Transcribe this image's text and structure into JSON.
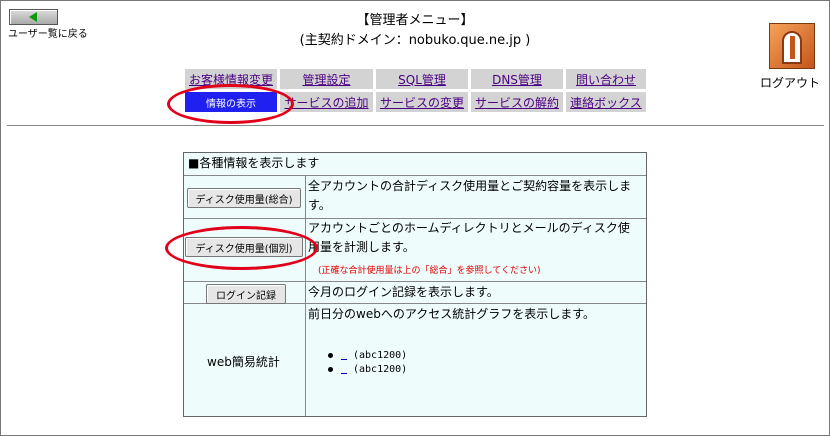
{
  "header": {
    "back_label": "ユーザー覧に戻る",
    "title": "【管理者メニュー】",
    "domain_line": "(主契約ドメイン：nobuko.que.ne.jp )",
    "logout_label": "ログアウト"
  },
  "menu": {
    "row1": [
      "お客様情報変更",
      "管理設定",
      "SQL管理",
      "DNS管理",
      "問い合わせ"
    ],
    "row2": [
      "情報の表示",
      "サービスの追加",
      "サービスの変更",
      "サービスの解約",
      "連絡ボックス"
    ],
    "active": "情報の表示"
  },
  "panel": {
    "heading": "■各種情報を表示します",
    "rows": [
      {
        "button": "ディスク使用量(総合)",
        "desc_line1": "全アカウントの合計ディスク使用量とご契約容量を表示しま",
        "desc_line2": "す。"
      },
      {
        "button": "ディスク使用量(個別)",
        "desc_line1": "アカウントごとのホームディレクトリとメールのディスク使",
        "desc_line2": "用量を計測します。",
        "note": "(正確な合計使用量は上の「総合」を参照してください)"
      },
      {
        "button": "ログイン記録",
        "desc_line1": "今月のログイン記録を表示します。"
      },
      {
        "label": "web簡易統計",
        "desc_line1": "前日分のwebへのアクセス統計グラフを表示します。",
        "items": [
          "(abc1200)",
          "(abc1200)"
        ]
      }
    ]
  },
  "colors": {
    "active_menu": "#2020f0",
    "menu_bg": "#d3d3d3",
    "annotation": "#e0001a",
    "panel_bg": "#eefcfc",
    "note": "#e00000"
  }
}
